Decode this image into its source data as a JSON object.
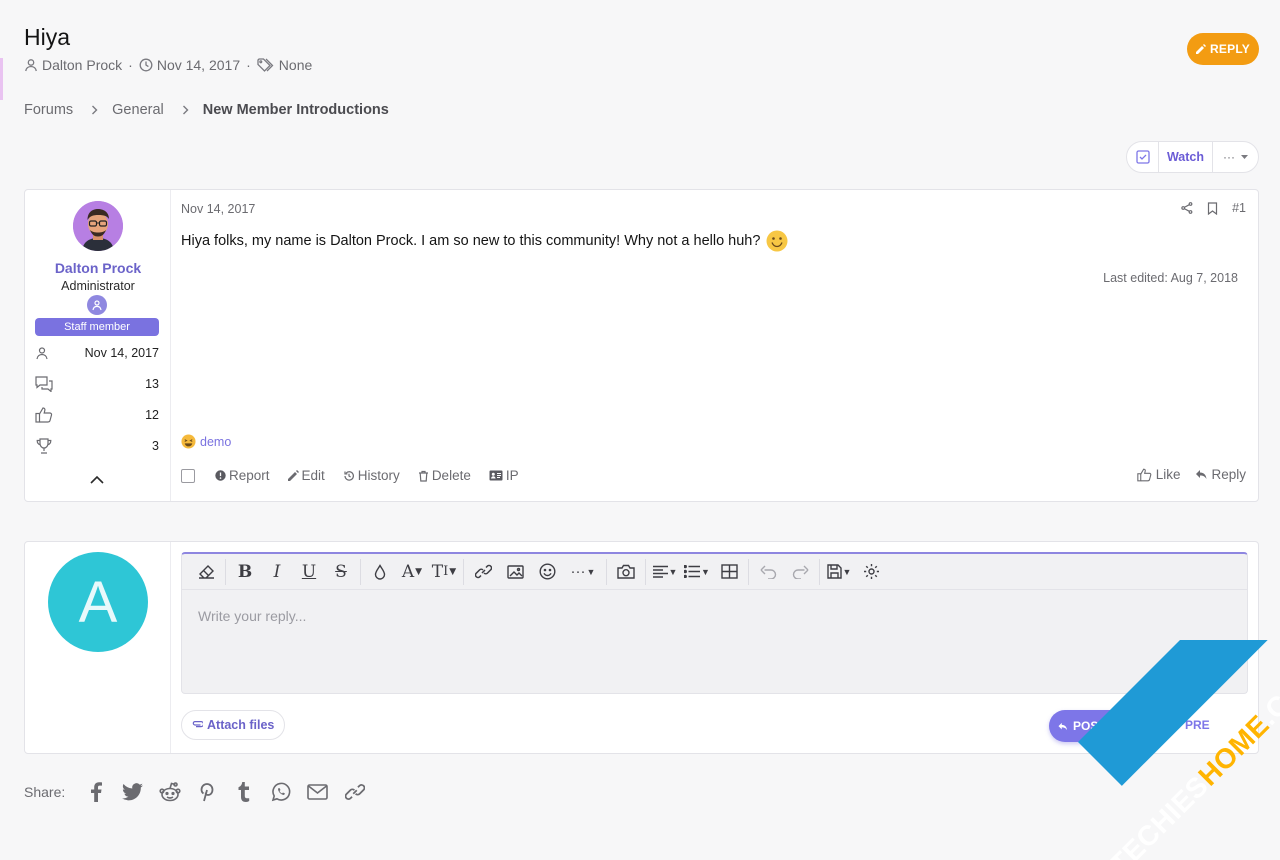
{
  "thread": {
    "title": "Hiya",
    "author": "Dalton Prock",
    "date": "Nov 14, 2017",
    "tags": "None",
    "reply_label": "REPLY"
  },
  "breadcrumb": [
    "Forums",
    "General",
    "New Member Introductions"
  ],
  "watch": {
    "label": "Watch",
    "more": "···"
  },
  "post": {
    "date": "Nov 14, 2017",
    "number": "#1",
    "body": "Hiya folks, my name is Dalton Prock. I am so new to this community! Why not a hello huh?",
    "last_edited": "Last edited: Aug 7, 2018",
    "reaction_user": "demo",
    "user": {
      "name": "Dalton Prock",
      "title": "Administrator",
      "badge": "Staff member",
      "joined": "Nov 14, 2017",
      "messages": "13",
      "reactions": "12",
      "points": "3"
    },
    "actions": {
      "report": "Report",
      "edit": "Edit",
      "history": "History",
      "delete": "Delete",
      "ip": "IP"
    },
    "like": "Like",
    "reply": "Reply"
  },
  "reply_editor": {
    "avatar_letter": "A",
    "placeholder": "Write your reply...",
    "attach": "Attach files",
    "post_reply": "POST REPLY",
    "preview": "PRE"
  },
  "share": {
    "label": "Share:"
  },
  "watermark": {
    "part1": "TECHIES",
    "part2": "HOME",
    "part3": ".COM"
  },
  "colors": {
    "accent": "#7d76e8",
    "reply_button": "#f39c12",
    "avatar": "#2ec6d6",
    "watermark": "#1f9ad6"
  }
}
